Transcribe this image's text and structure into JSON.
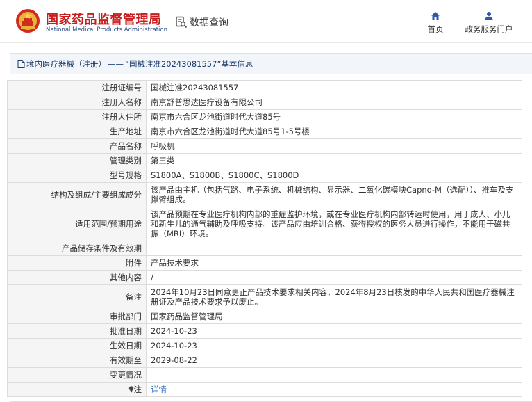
{
  "header": {
    "title_cn": "国家药品监督管理局",
    "title_en": "National Medical Products Administration",
    "query_label": "数据查询",
    "nav": [
      {
        "label": "首页",
        "icon": "home-icon"
      },
      {
        "label": "政务服务门户",
        "icon": "user-icon"
      }
    ],
    "brand_color": "#c81d1d"
  },
  "breadcrumb": {
    "category": "境内医疗器械（注册）",
    "separator": "——",
    "detail": "“国械注准20243081557”基本信息"
  },
  "fields": [
    {
      "label": "注册证编号",
      "value": "国械注准20243081557"
    },
    {
      "label": "注册人名称",
      "value": "南京舒普思达医疗设备有限公司"
    },
    {
      "label": "注册人住所",
      "value": "南京市六合区龙池街道时代大道85号"
    },
    {
      "label": "生产地址",
      "value": "南京市六合区龙池街道时代大道85号1-5号楼"
    },
    {
      "label": "产品名称",
      "value": "呼吸机"
    },
    {
      "label": "管理类别",
      "value": "第三类"
    },
    {
      "label": "型号规格",
      "value": "S1800A、S1800B、S1800C、S1800D"
    },
    {
      "label": "结构及组成/主要组成成分",
      "value": "该产品由主机（包括气路、电子系统、机械结构、显示器、二氧化碳模块Capno-M（选配））、推车及支撑臂组成。"
    },
    {
      "label": "适用范围/预期用途",
      "value": "该产品预期在专业医疗机构内部的重症监护环境，或在专业医疗机构内部转运时使用，用于成人、小儿和新生儿的通气辅助及呼吸支持。该产品应由培训合格、获得授权的医务人员进行操作，不能用于磁共振（MRI）环境。"
    },
    {
      "label": "产品储存条件及有效期",
      "value": ""
    },
    {
      "label": "附件",
      "value": "产品技术要求"
    },
    {
      "label": "其他内容",
      "value": "/"
    },
    {
      "label": "备注",
      "value": "2024年10月23日同意更正产品技术要求相关内容，2024年8月23日核发的中华人民共和国医疗器械注册证及产品技术要求予以废止。"
    },
    {
      "label": "审批部门",
      "value": "国家药品监督管理局"
    },
    {
      "label": "批准日期",
      "value": "2024-10-23"
    },
    {
      "label": "生效日期",
      "value": "2024-10-23"
    },
    {
      "label": "有效期至",
      "value": "2029-08-22"
    },
    {
      "label": "变更情况",
      "value": ""
    },
    {
      "label": "注",
      "value": "详情"
    }
  ]
}
